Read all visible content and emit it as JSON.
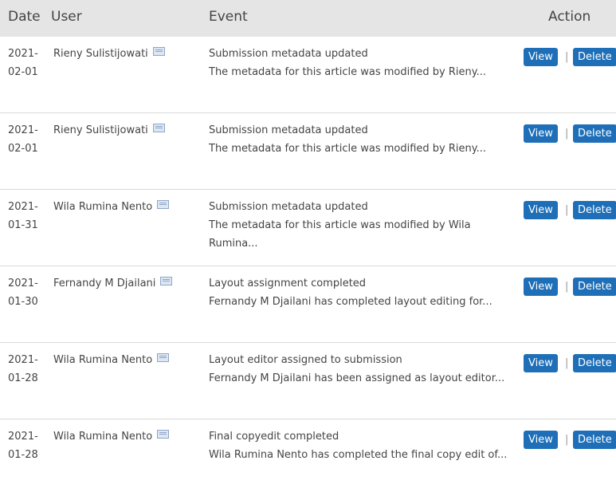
{
  "header": {
    "date": "Date",
    "user": "User",
    "event": "Event",
    "action": "Action"
  },
  "actions": {
    "view": "View",
    "separator": "|",
    "delete": "Delete"
  },
  "rows": [
    {
      "date": "2021-02-01",
      "user": "Rieny Sulistijowati",
      "event_title": "Submission metadata updated",
      "event_desc": "The metadata for this article was modified by Rieny..."
    },
    {
      "date": "2021-02-01",
      "user": "Rieny Sulistijowati",
      "event_title": "Submission metadata updated",
      "event_desc": "The metadata for this article was modified by Rieny..."
    },
    {
      "date": "2021-01-31",
      "user": "Wila Rumina Nento",
      "event_title": "Submission metadata updated",
      "event_desc": "The metadata for this article was modified by Wila Rumina..."
    },
    {
      "date": "2021-01-30",
      "user": "Fernandy M Djailani",
      "event_title": "Layout assignment completed",
      "event_desc": "Fernandy M Djailani has completed layout editing for..."
    },
    {
      "date": "2021-01-28",
      "user": "Wila Rumina Nento",
      "event_title": "Layout editor assigned to submission",
      "event_desc": "Fernandy M Djailani has been assigned as layout editor..."
    },
    {
      "date": "2021-01-28",
      "user": "Wila Rumina Nento",
      "event_title": "Final copyedit completed",
      "event_desc": "Wila Rumina Nento has completed the final copy edit of..."
    }
  ],
  "icons": {
    "user_email": "envelope-icon"
  },
  "colors": {
    "header_bg": "#e5e5e5",
    "button_bg": "#1e6fb8",
    "button_text": "#ffffff",
    "divider": "#d9d9d9"
  }
}
